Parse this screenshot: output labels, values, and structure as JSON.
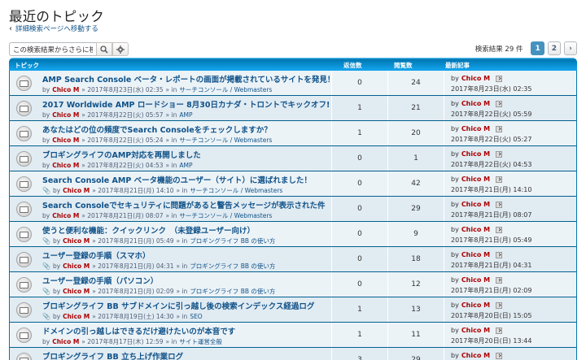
{
  "page": {
    "title": "最近のトピック",
    "back_link": "詳細検索ページへ移動する"
  },
  "search": {
    "value": "この検索結果からさらに検",
    "placeholder": "この検索結果からさらに検"
  },
  "pagination": {
    "count_text": "検索結果 29 件",
    "pages": [
      "1",
      "2"
    ],
    "current": "1",
    "next_icon": "chevron-right-icon"
  },
  "columns": {
    "topic": "トピック",
    "replies": "返信数",
    "views": "閲覧数",
    "last_post": "最新記事"
  },
  "by_word": "by",
  "in_word": "» in",
  "colors": {
    "header_blue": "#12a3eb",
    "panel_blue": "#0076b1",
    "link_blue": "#105289",
    "author_red": "#aa0000",
    "row_light": "#ecf3f7",
    "row_alt": "#e1ebf2",
    "active_page": "#4692bf"
  },
  "topics": [
    {
      "title": "AMP Search Console ベータ・レポートの画面が掲載されているサイトを発見！",
      "author": "Chico M",
      "date": "» 2017年8月23日(水) 02:35",
      "forums": "サーチコンソール / Webmasters",
      "attachment": false,
      "replies": "0",
      "views": "24",
      "last_author": "Chico M",
      "last_date": "2017年8月23日(水) 02:35"
    },
    {
      "title": "2017 Worldwide AMP ロードショー 8月30日カナダ・トロントでキックオフ!",
      "author": "Chico M",
      "date": "» 2017年8月22日(火) 05:57",
      "forums": "AMP",
      "attachment": false,
      "replies": "1",
      "views": "21",
      "last_author": "Chico M",
      "last_date": "2017年8月22日(火) 05:59"
    },
    {
      "title": "あなたはどの位の頻度でSearch Consoleをチェックしますか？",
      "author": "Chico M",
      "date": "» 2017年8月22日(火) 05:24",
      "forums": "サーチコンソール / Webmasters",
      "attachment": false,
      "replies": "1",
      "views": "20",
      "last_author": "Chico M",
      "last_date": "2017年8月22日(火) 05:27"
    },
    {
      "title": "ブロギングライフのAMP対応を再開しました",
      "author": "Chico M",
      "date": "» 2017年8月22日(火) 04:53",
      "forums": "AMP",
      "attachment": false,
      "replies": "0",
      "views": "1",
      "last_author": "Chico M",
      "last_date": "2017年8月22日(火) 04:53"
    },
    {
      "title": "Search Console AMP ベータ機能のユーザー（サイト）に選ばれました！",
      "author": "Chico M",
      "date": "» 2017年8月21日(月) 14:10",
      "forums": "サーチコンソール / Webmasters",
      "attachment": true,
      "replies": "0",
      "views": "42",
      "last_author": "Chico M",
      "last_date": "2017年8月21日(月) 14:10"
    },
    {
      "title": "Search Consoleでセキュリティに問題があると警告メッセージが表示された件",
      "author": "Chico M",
      "date": "» 2017年8月21日(月) 08:07",
      "forums": "サーチコンソール / Webmasters",
      "attachment": false,
      "replies": "0",
      "views": "29",
      "last_author": "Chico M",
      "last_date": "2017年8月21日(月) 08:07"
    },
    {
      "title": "使うと便利な機能：クイックリンク　（未登録ユーザー向け）",
      "author": "Chico M",
      "date": "» 2017年8月21日(月) 05:49",
      "forums": "ブロギングライフ BB の使い方",
      "attachment": true,
      "replies": "0",
      "views": "9",
      "last_author": "Chico M",
      "last_date": "2017年8月21日(月) 05:49"
    },
    {
      "title": "ユーザー登録の手順（スマホ）",
      "author": "Chico M",
      "date": "» 2017年8月21日(月) 04:31",
      "forums": "ブロギングライフ BB の使い方",
      "attachment": true,
      "replies": "0",
      "views": "18",
      "last_author": "Chico M",
      "last_date": "2017年8月21日(月) 04:31"
    },
    {
      "title": "ユーザー登録の手順（パソコン）",
      "author": "Chico M",
      "date": "» 2017年8月21日(月) 02:09",
      "forums": "ブロギングライフ BB の使い方",
      "attachment": true,
      "replies": "0",
      "views": "12",
      "last_author": "Chico M",
      "last_date": "2017年8月21日(月) 02:09"
    },
    {
      "title": "ブロギングライフ BB サブドメインに引っ越し後の検索インデックス経過ログ",
      "author": "Chico M",
      "date": "» 2017年8月19日(土) 14:30",
      "forums": "SEO",
      "attachment": true,
      "replies": "1",
      "views": "13",
      "last_author": "Chico M",
      "last_date": "2017年8月20日(日) 15:05"
    },
    {
      "title": "ドメインの引っ越しはできるだけ避けたいのが本音です",
      "author": "Chico M",
      "date": "» 2017年8月17日(木) 12:59",
      "forums": "サイト運営全般",
      "attachment": false,
      "replies": "1",
      "views": "11",
      "last_author": "Chico M",
      "last_date": "2017年8月20日(日) 13:44"
    },
    {
      "title": "ブロギングライフ BB 立ち上げ作業ログ",
      "author": "",
      "date": "",
      "forums": "",
      "attachment": false,
      "replies": "3",
      "views": "29",
      "last_author": "Chico M",
      "last_date": ""
    }
  ]
}
